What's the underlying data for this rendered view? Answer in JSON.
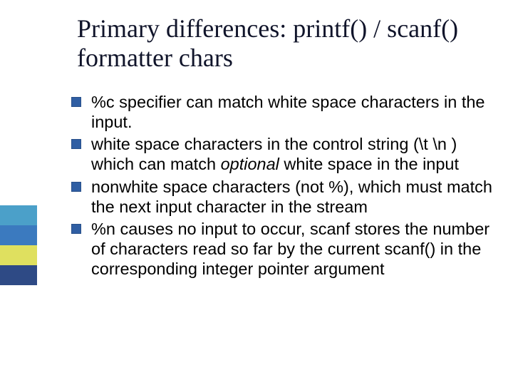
{
  "title": "Primary differences: printf() / scanf() formatter chars",
  "stripes": [
    "#4ba0c9",
    "#3b7abf",
    "#dfe05f",
    "#2e4a85"
  ],
  "bullets": [
    {
      "segments": [
        {
          "t": "%c specifier can match white space characters in the input."
        }
      ]
    },
    {
      "segments": [
        {
          "t": "white space characters in the control string (\\t \\n  ) which can match "
        },
        {
          "t": "optional",
          "italic": true
        },
        {
          "t": " white space in the input"
        }
      ]
    },
    {
      "segments": [
        {
          "t": "nonwhite space characters (not %), which must match the next input character in the stream"
        }
      ]
    },
    {
      "segments": [
        {
          "t": "%n causes no input to occur, scanf stores the number of characters read so far by the current scanf() in the corresponding integer pointer argument"
        }
      ]
    }
  ]
}
